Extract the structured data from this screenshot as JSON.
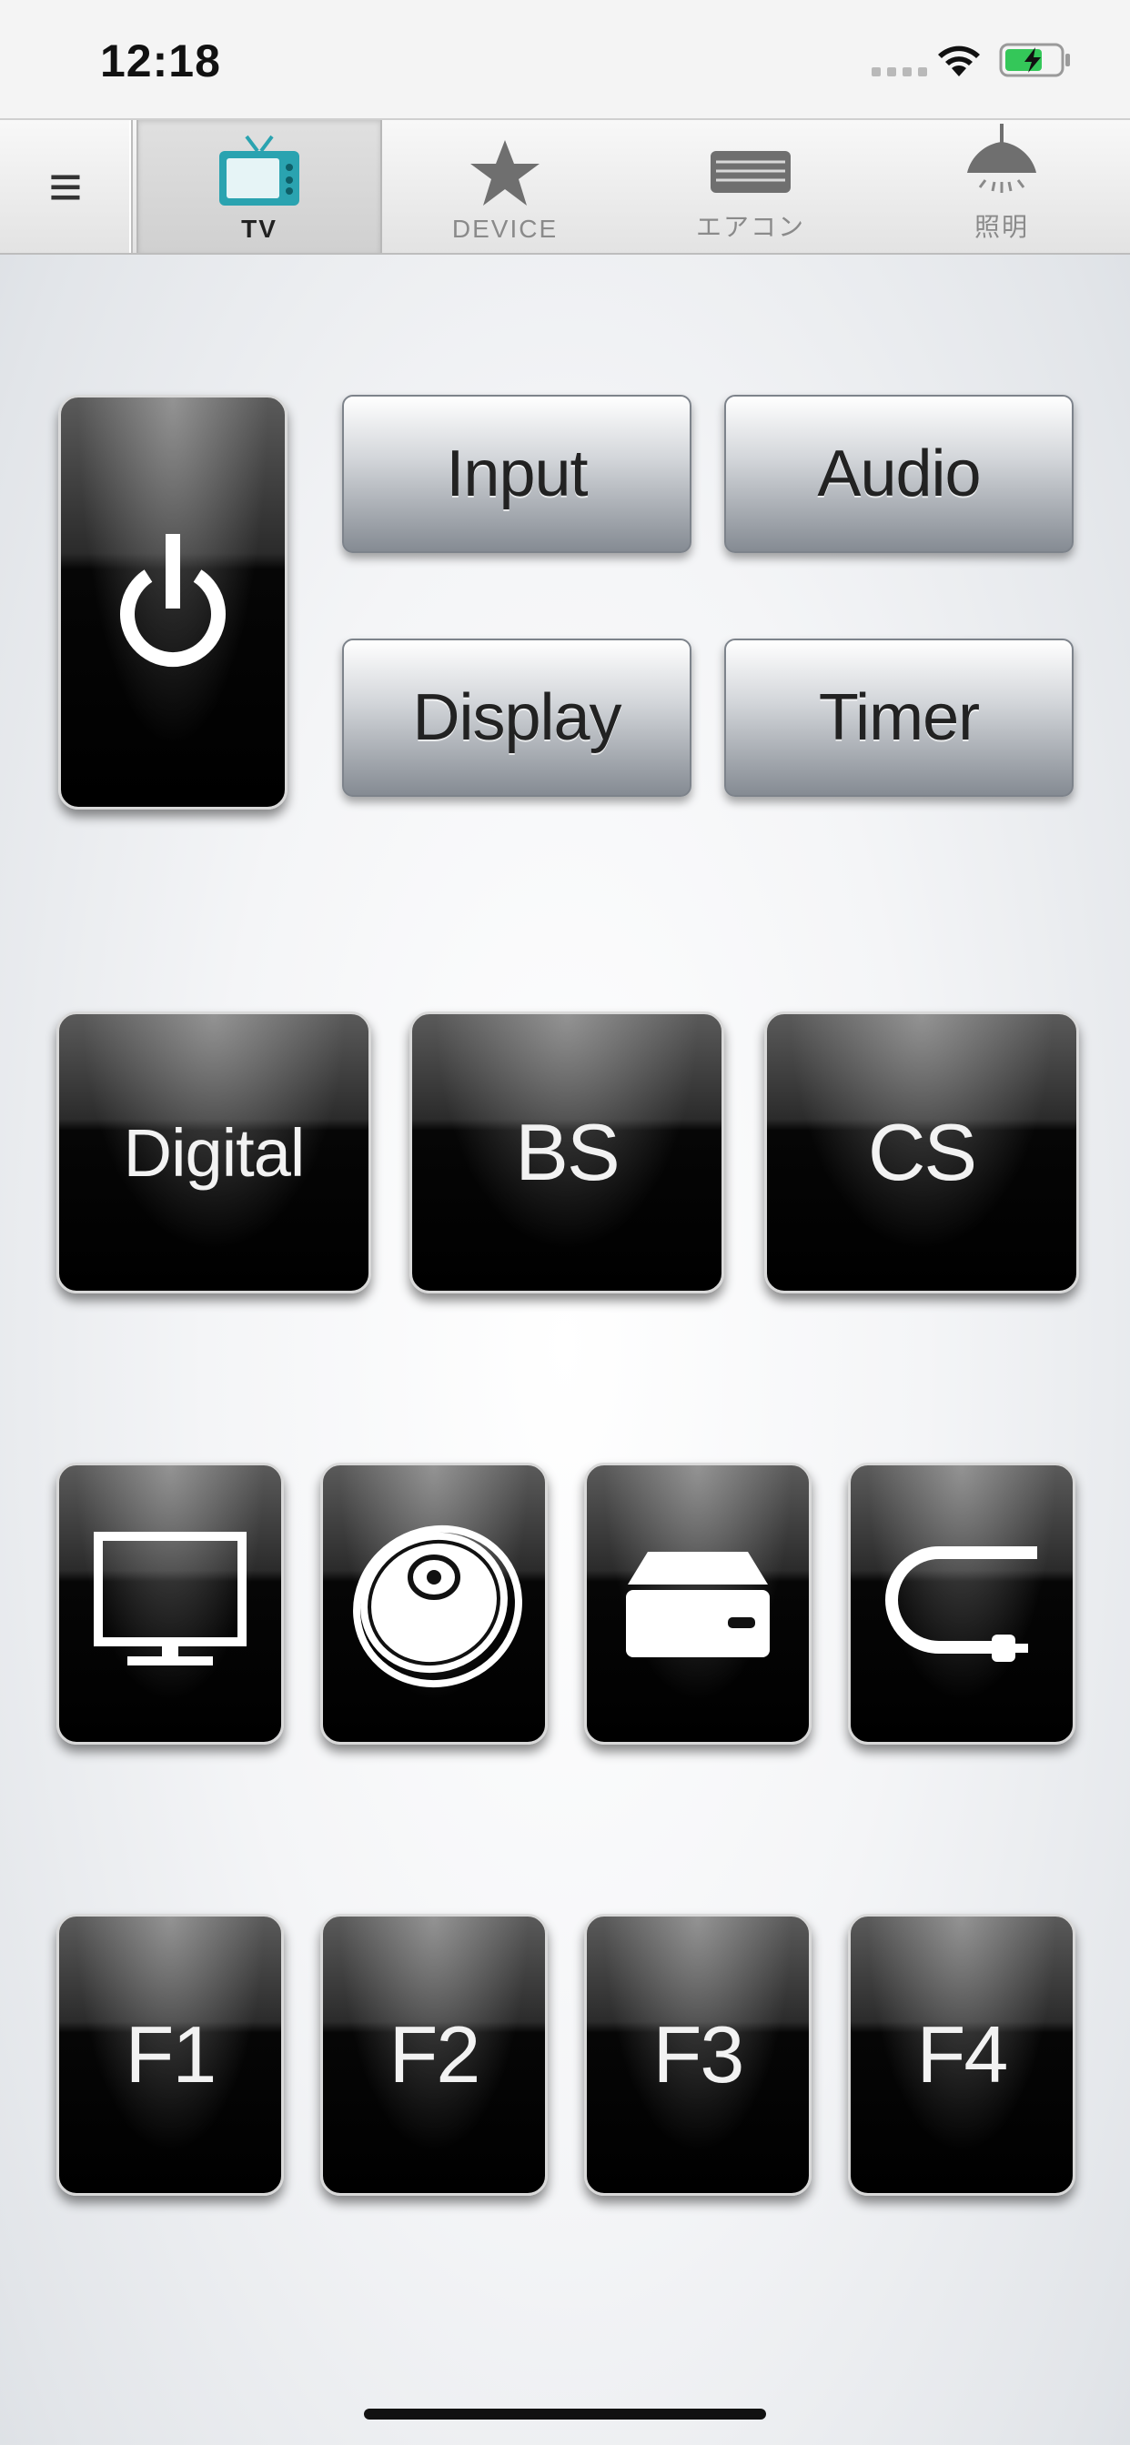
{
  "status_bar": {
    "time": "12:18",
    "battery_color": "#34c759"
  },
  "nav": {
    "menu_icon": "hamburger-icon",
    "menu_glyph": "≡",
    "tabs": [
      {
        "label": "TV",
        "icon": "tv-icon",
        "active": true,
        "accent": "#2aa3b0"
      },
      {
        "label": "DEVICE",
        "icon": "star-icon",
        "active": false
      },
      {
        "label": "エアコン",
        "icon": "air-conditioner-icon",
        "active": false
      },
      {
        "label": "照明",
        "icon": "ceiling-lamp-icon",
        "active": false
      }
    ]
  },
  "remote": {
    "power_icon": "power-icon",
    "function_buttons": [
      {
        "label": "Input"
      },
      {
        "label": "Audio"
      },
      {
        "label": "Display"
      },
      {
        "label": "Timer"
      }
    ],
    "broadcast_buttons": [
      {
        "label": "Digital"
      },
      {
        "label": "BS"
      },
      {
        "label": "CS"
      }
    ],
    "source_buttons": [
      {
        "icon": "monitor-icon"
      },
      {
        "icon": "disc-icon"
      },
      {
        "icon": "hard-drive-icon"
      },
      {
        "icon": "cable-plug-icon"
      }
    ],
    "f_buttons": [
      {
        "label": "F1"
      },
      {
        "label": "F2"
      },
      {
        "label": "F3"
      },
      {
        "label": "F4"
      }
    ]
  }
}
